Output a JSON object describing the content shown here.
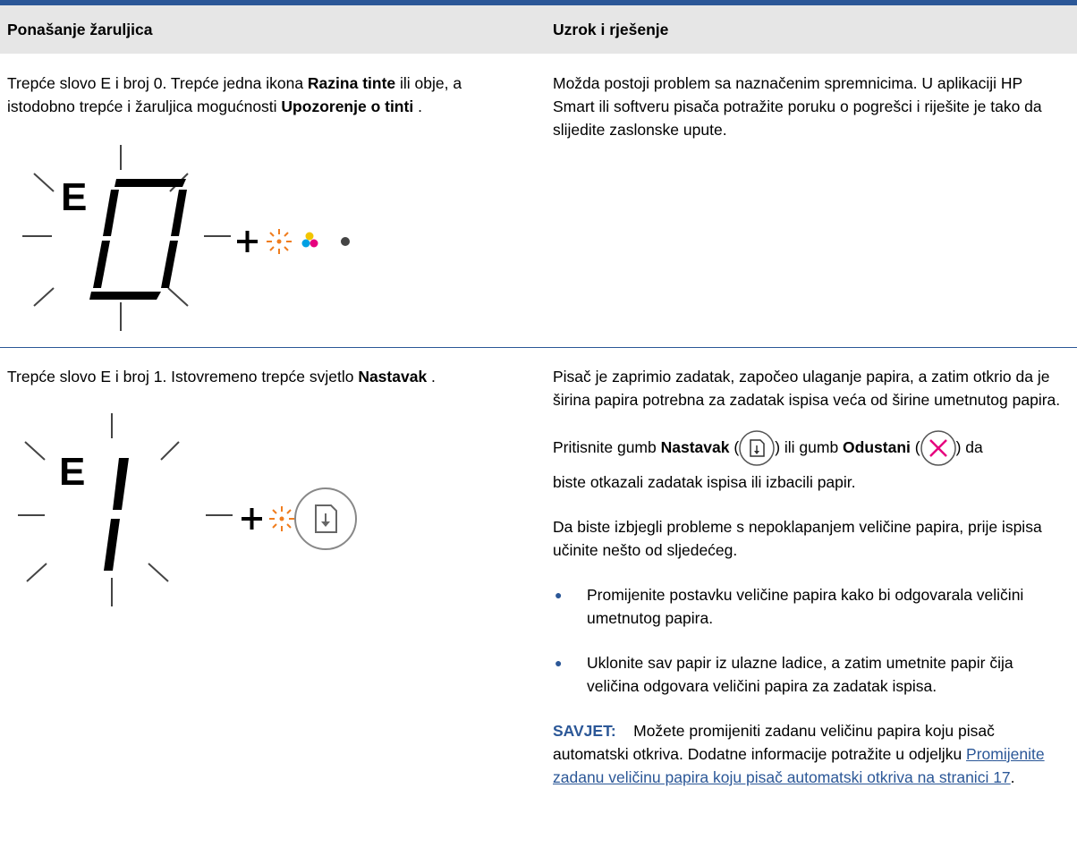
{
  "table": {
    "header": {
      "col1": "Ponašanje žaruljica",
      "col2": "Uzrok i rješenje"
    },
    "row1": {
      "behavior": {
        "text_a": "Trepće slovo E i broj 0. Trepće jedna ikona ",
        "bold_a": "Razina tinte",
        "text_b": " ili obje, a istodobno trepće i žaruljica mogućnosti ",
        "bold_b": "Upozorenje o tinti",
        "text_c": " ."
      },
      "display": {
        "letter": "E",
        "digit": "0"
      },
      "solution": "Možda postoji problem sa naznačenim spremnicima. U aplikaciji HP Smart ili softveru pisača potražite poruku o pogrešci i riješite je tako da slijedite zaslonske upute."
    },
    "row2": {
      "behavior": {
        "text_a": "Trepće slovo E i broj 1. Istovremeno trepće svjetlo ",
        "bold_a": "Nastavak",
        "text_b": " ."
      },
      "display": {
        "letter": "E",
        "digit": "1"
      },
      "solution_p1": "Pisač je zaprimio zadatak, započeo ulaganje papira, a zatim otkrio da je širina papira potrebna za zadatak ispisa veća od širine umetnutog papira.",
      "solution_p2": {
        "t1": "Pritisnite gumb ",
        "b1": "Nastavak",
        "t2": " (",
        "t3": ") ili gumb ",
        "b2": "Odustani",
        "t4": " (",
        "t5": ") da",
        "line2": "biste otkazali zadatak ispisa ili izbacili papir."
      },
      "solution_p3": "Da biste izbjegli probleme s nepoklapanjem veličine papira, prije ispisa učinite nešto od sljedećeg.",
      "bullets": [
        "Promijenite postavku veličine papira kako bi odgovarala veličini umetnutog papira.",
        "Uklonite sav papir iz ulazne ladice, a zatim umetnite papir čija veličina odgovara veličini papira za zadatak ispisa."
      ],
      "tip": {
        "label": "SAVJET:",
        "text": "Možete promijeniti zadanu veličinu papira koju pisač automatski otkriva. Dodatne informacije potražite u odjeljku ",
        "link": "Promijenite zadanu veličinu papira koju pisač automatski otkriva na stranici 17",
        "end": "."
      }
    }
  },
  "colors": {
    "accent": "#2b5797",
    "header_bg": "#e6e6e6",
    "blink_orange": "#f07d1e",
    "cancel_pink": "#e6007e"
  },
  "icons": {
    "warning": "ink-alert-blink-icon",
    "color_ink": "color-ink-level-icon",
    "black_ink": "black-ink-level-icon",
    "resume": "resume-button-icon",
    "cancel": "cancel-button-icon"
  }
}
